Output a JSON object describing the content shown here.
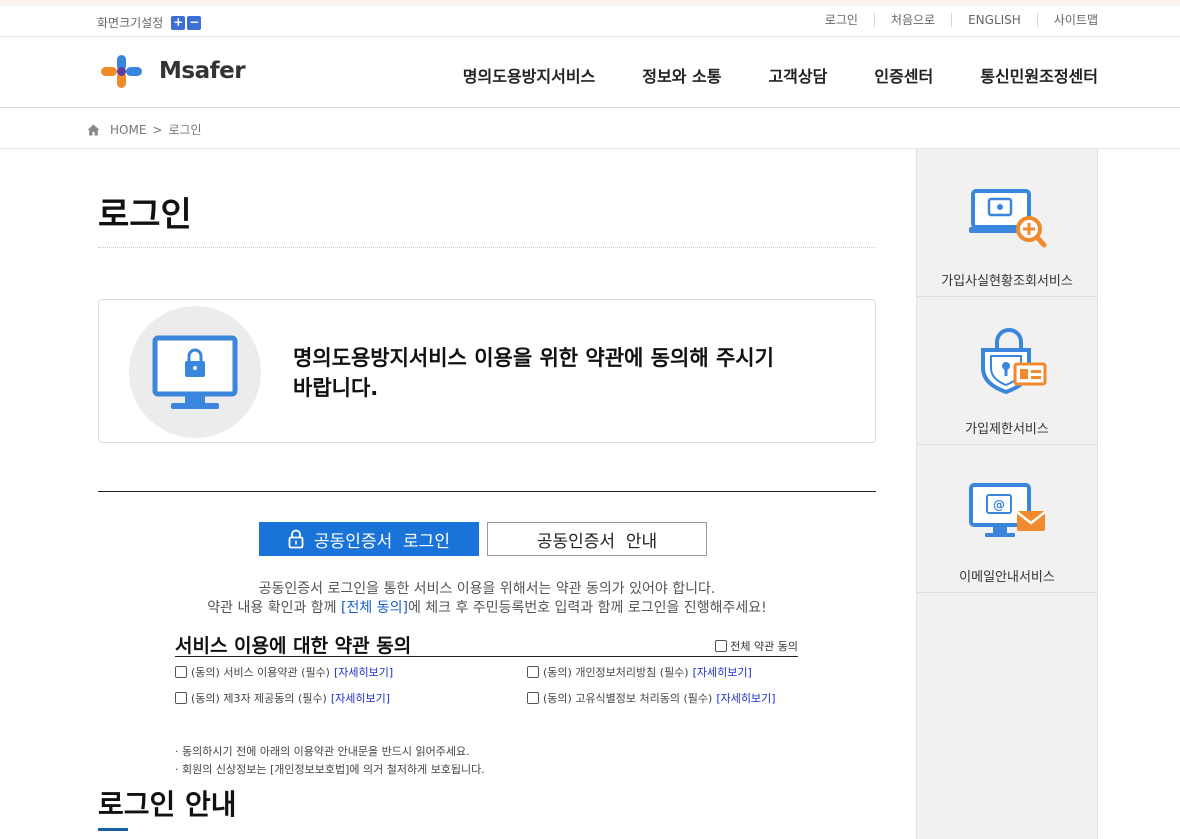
{
  "util": {
    "fontsize_label": "화면크기설정",
    "plus": "+",
    "minus": "−",
    "links": [
      "로그인",
      "처음으로",
      "ENGLISH",
      "사이트맵"
    ]
  },
  "logo": {
    "text": "Msafer"
  },
  "gnb": [
    "명의도용방지서비스",
    "정보와 소통",
    "고객상담",
    "인증센터",
    "통신민원조정센터"
  ],
  "breadcrumb": {
    "home": "HOME",
    "separator": ">",
    "current": "로그인"
  },
  "page": {
    "title": "로그인",
    "notice_line1": "명의도용방지서비스 이용을 위한 약관에 동의해 주시기",
    "notice_line2": "바랍니다."
  },
  "tabs": {
    "active": "공동인증서  로그인",
    "inactive": "공동인증서  안내"
  },
  "desc": {
    "line1": "공동인증서 로그인을 통한 서비스 이용을 위해서는 약관 동의가 있어야 합니다.",
    "line2_pre": "약관 내용 확인과 함께 ",
    "line2_hl": "[전체 동의]",
    "line2_post": "에 체크 후 주민등록번호 입력과 함께 로그인을 진행해주세요!"
  },
  "terms": {
    "title": "서비스 이용에 대한 약관 동의",
    "all_agree": "전체 약관 동의",
    "items": [
      {
        "label": "(동의) 서비스 이용약관 (필수)",
        "link": "[자세히보기]"
      },
      {
        "label": "(동의) 개인정보처리방침 (필수)",
        "link": "[자세히보기]"
      },
      {
        "label": "(동의) 제3자 제공동의 (필수)",
        "link": "[자세히보기]"
      },
      {
        "label": "(동의) 고유식별정보 처리동의 (필수)",
        "link": "[자세히보기]"
      }
    ],
    "note1": "· 동의하시기 전에 아래의 이용약관 안내문을 반드시 읽어주세요.",
    "note2": "· 회원의 신상정보는 [개인정보보호법]에 의거 철저하게 보호됩니다."
  },
  "section2": {
    "title": "로그인 안내"
  },
  "aside": [
    {
      "label": "가입사실현황조회서비스",
      "icon": "laptop-search-icon"
    },
    {
      "label": "가입제한서비스",
      "icon": "shield-lock-icon"
    },
    {
      "label": "이메일안내서비스",
      "icon": "monitor-mail-icon"
    }
  ],
  "colors": {
    "accent": "#1a73d9",
    "icon_blue": "#3b86dd",
    "icon_orange": "#f08a2c"
  }
}
